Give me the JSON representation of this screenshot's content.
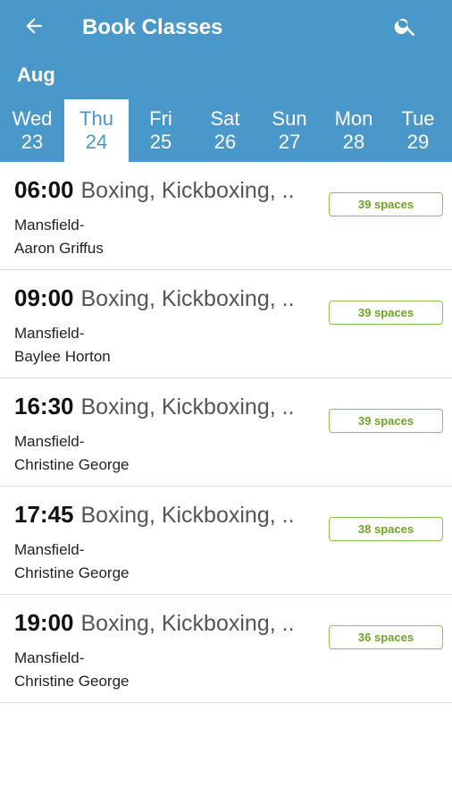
{
  "header": {
    "title": "Book Classes",
    "month": "Aug"
  },
  "days": [
    {
      "dow": "Wed",
      "num": "23"
    },
    {
      "dow": "Thu",
      "num": "24"
    },
    {
      "dow": "Fri",
      "num": "25"
    },
    {
      "dow": "Sat",
      "num": "26"
    },
    {
      "dow": "Sun",
      "num": "27"
    },
    {
      "dow": "Mon",
      "num": "28"
    },
    {
      "dow": "Tue",
      "num": "29"
    }
  ],
  "selected_day_index": 1,
  "classes": [
    {
      "time": "06:00",
      "name": "Boxing, Kickboxing, ...",
      "location": "Mansfield-",
      "instructor": "Aaron Griffus",
      "spaces": "39 spaces"
    },
    {
      "time": "09:00",
      "name": "Boxing, Kickboxing, ...",
      "location": "Mansfield-",
      "instructor": "Baylee Horton",
      "spaces": "39 spaces"
    },
    {
      "time": "16:30",
      "name": "Boxing, Kickboxing, ...",
      "location": "Mansfield-",
      "instructor": "Christine George",
      "spaces": "39 spaces"
    },
    {
      "time": "17:45",
      "name": "Boxing, Kickboxing, ...",
      "location": "Mansfield-",
      "instructor": "Christine George",
      "spaces": "38 spaces"
    },
    {
      "time": "19:00",
      "name": "Boxing, Kickboxing, ...",
      "location": "Mansfield-",
      "instructor": "Christine George",
      "spaces": "36 spaces"
    }
  ],
  "colors": {
    "header": "#4a97c9",
    "badge": "#8bc34a"
  },
  "icons": {
    "back": "arrow-left-icon",
    "search": "search-icon"
  }
}
